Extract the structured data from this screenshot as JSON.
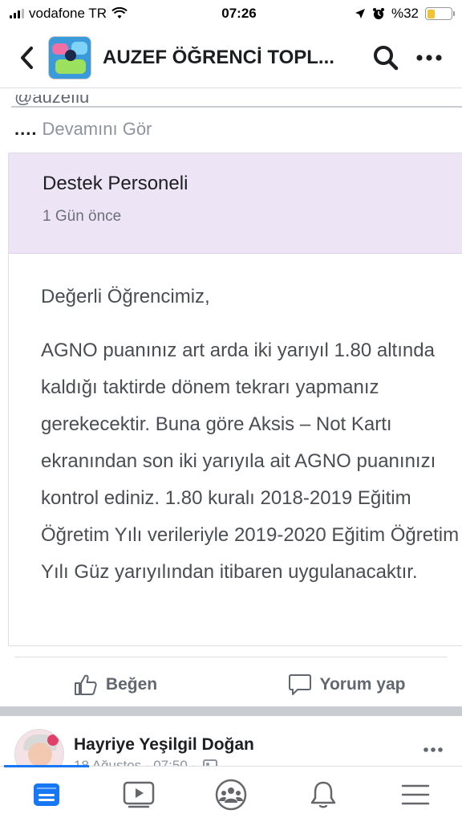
{
  "status_bar": {
    "carrier": "vodafone TR",
    "time": "07:26",
    "battery_text": "%32",
    "battery_level": 0.32,
    "battery_color": "#f2c230"
  },
  "header": {
    "title": "AUZEF ÖĞRENCİ TOPL...",
    "back_icon": "chevron-left-icon",
    "search_icon": "search-icon",
    "more_icon": "more-horizontal-icon"
  },
  "post": {
    "clipped_text": "@auzefiu",
    "ellipsis": "....",
    "see_more": "Devamını Gör",
    "notice": {
      "sender": "Destek Personeli",
      "time_ago": "1 Gün önce",
      "header_color": "#ede5f6",
      "greeting": "Değerli Öğrencimiz,",
      "lines": [
        "AGNO puanınız art arda iki yarıyıl 1.80 altında",
        "kaldığı taktirde dönem tekrarı yapmanız",
        "gerekecektir. Buna göre Aksis – Not Kartı",
        "ekranından son iki yarıyıla ait AGNO puanınızı",
        "kontrol ediniz. 1.80 kuralı 2018-2019 Eğitim",
        "Öğretim Yılı verileriyle 2019-2020 Eğitim Öğretim",
        "Yılı Güz yarıyılından itibaren uygulanacaktır."
      ]
    },
    "actions": {
      "like": "Beğen",
      "comment": "Yorum yap"
    }
  },
  "next_post": {
    "author": "Hayriye Yeşilgil Doğan",
    "meta": "18 Ağustos · 07:50 ·"
  },
  "bottom_nav": {
    "items": [
      "feed-icon",
      "video-icon",
      "groups-icon",
      "notifications-icon",
      "menu-icon"
    ],
    "active_color": "#1877f2"
  }
}
